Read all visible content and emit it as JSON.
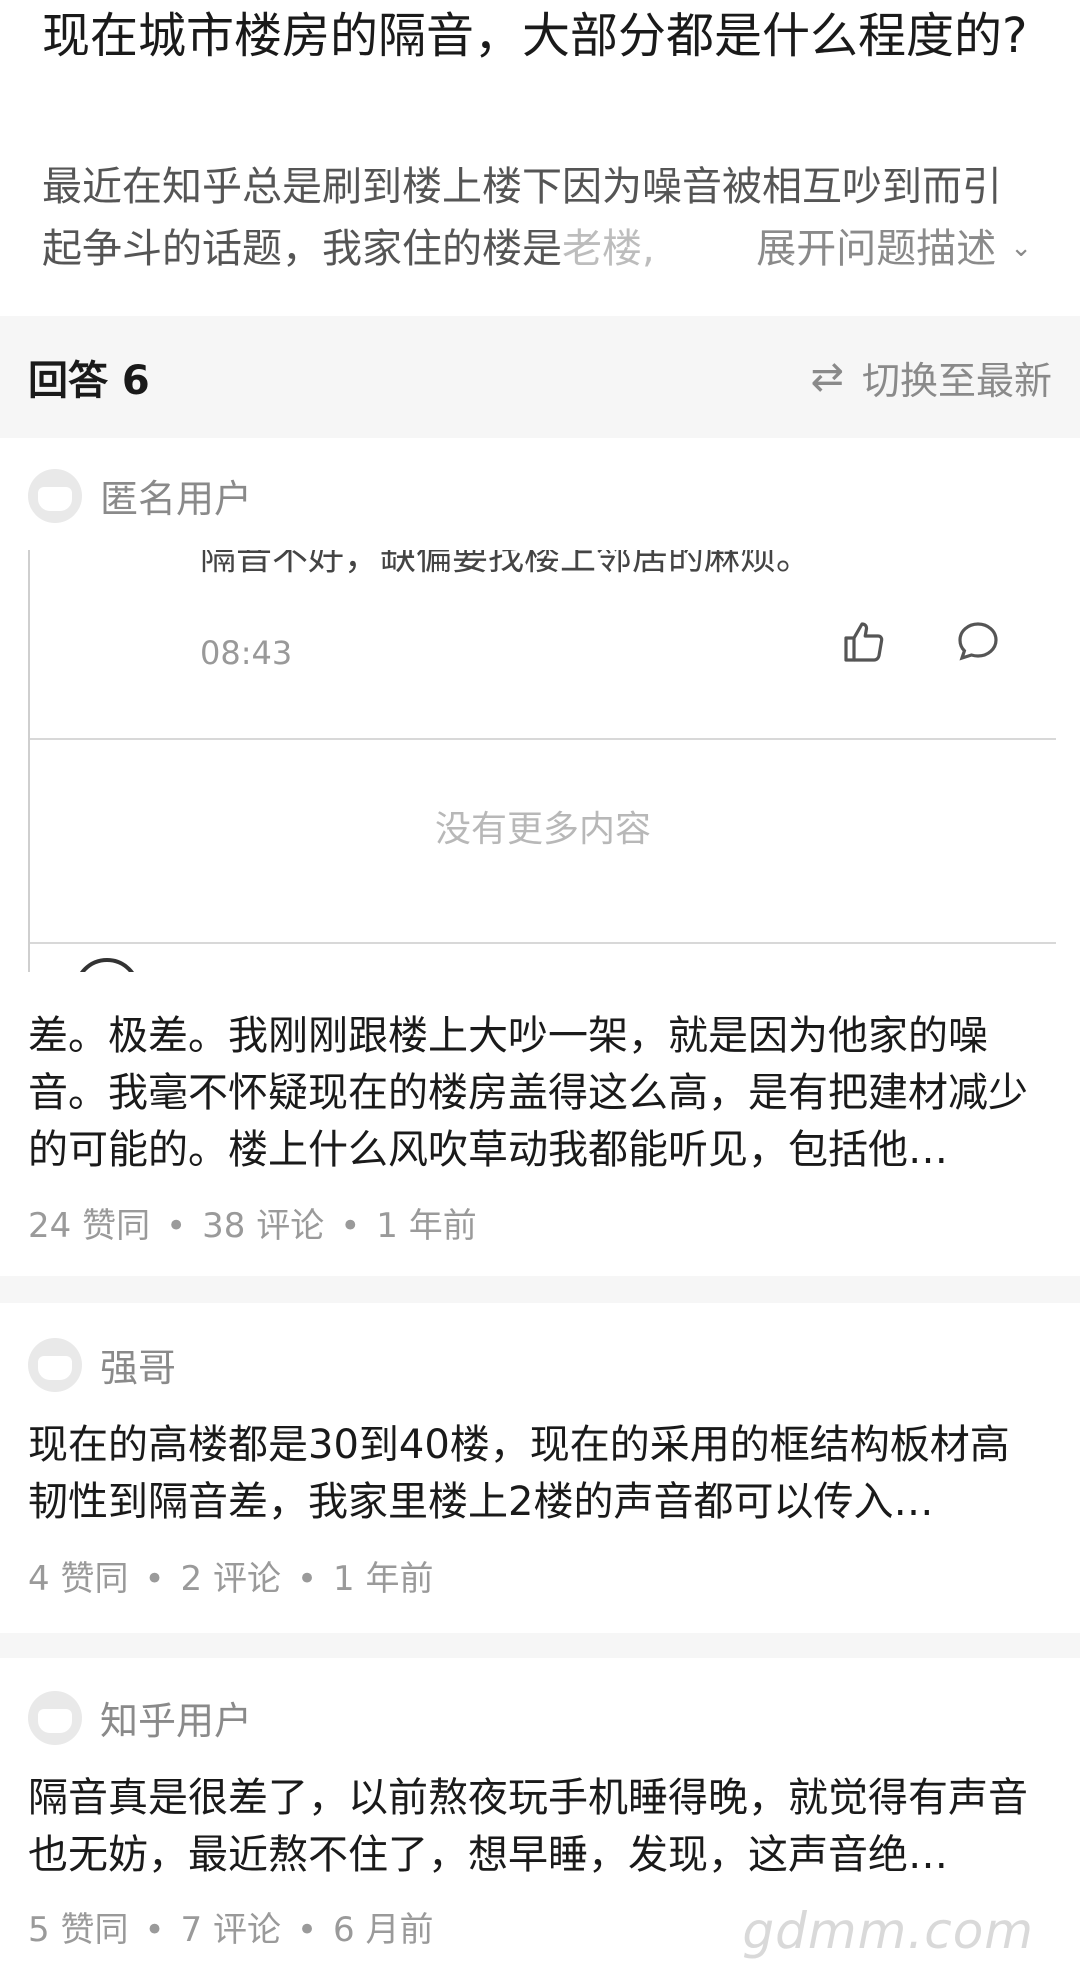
{
  "question": {
    "title": "现在城市楼房的隔音，大部分都是什么程度的?",
    "description": "最近在知乎总是刷到楼上楼下因为噪音被相互吵到而引起争斗的话题，我家住的楼是",
    "description_fade": "老楼,",
    "expand_label": "展开问题描述"
  },
  "answers_header": {
    "count_label": "回答 6",
    "sort_label": "切换至最新"
  },
  "answers": [
    {
      "author": "匿名用户",
      "embedded": {
        "cut_text": "隔音不好，缺偏要找楼上邻居的麻烦。",
        "time": "08:43",
        "no_more": "没有更多内容"
      },
      "excerpt": "差。极差。我刚刚跟楼上大吵一架，就是因为他家的噪音。我毫不怀疑现在的楼房盖得这么高，是有把建材减少的可能的。楼上什么风吹草动我都能听见，包括他…",
      "likes": "24 赞同",
      "comments": "38 评论",
      "time": "1 年前"
    },
    {
      "author": "强哥",
      "excerpt": "现在的高楼都是30到40楼，现在的采用的框结构板材高韧性到隔音差，我家里楼上2楼的声音都可以传入…",
      "likes": "4 赞同",
      "comments": "2 评论",
      "time": "1 年前"
    },
    {
      "author": "知乎用户",
      "excerpt": "隔音真是很差了，以前熬夜玩手机睡得晚，就觉得有声音也无妨，最近熬不住了，想早睡，发现，这声音绝…",
      "likes": "5 赞同",
      "comments": "7 评论",
      "time": "6 月前"
    }
  ],
  "watermark": "gdmm.com",
  "icons": {
    "expand": "chevron-down-icon",
    "sort": "swap-icon",
    "like": "thumbs-up-icon",
    "comment": "comment-bubble-icon"
  }
}
